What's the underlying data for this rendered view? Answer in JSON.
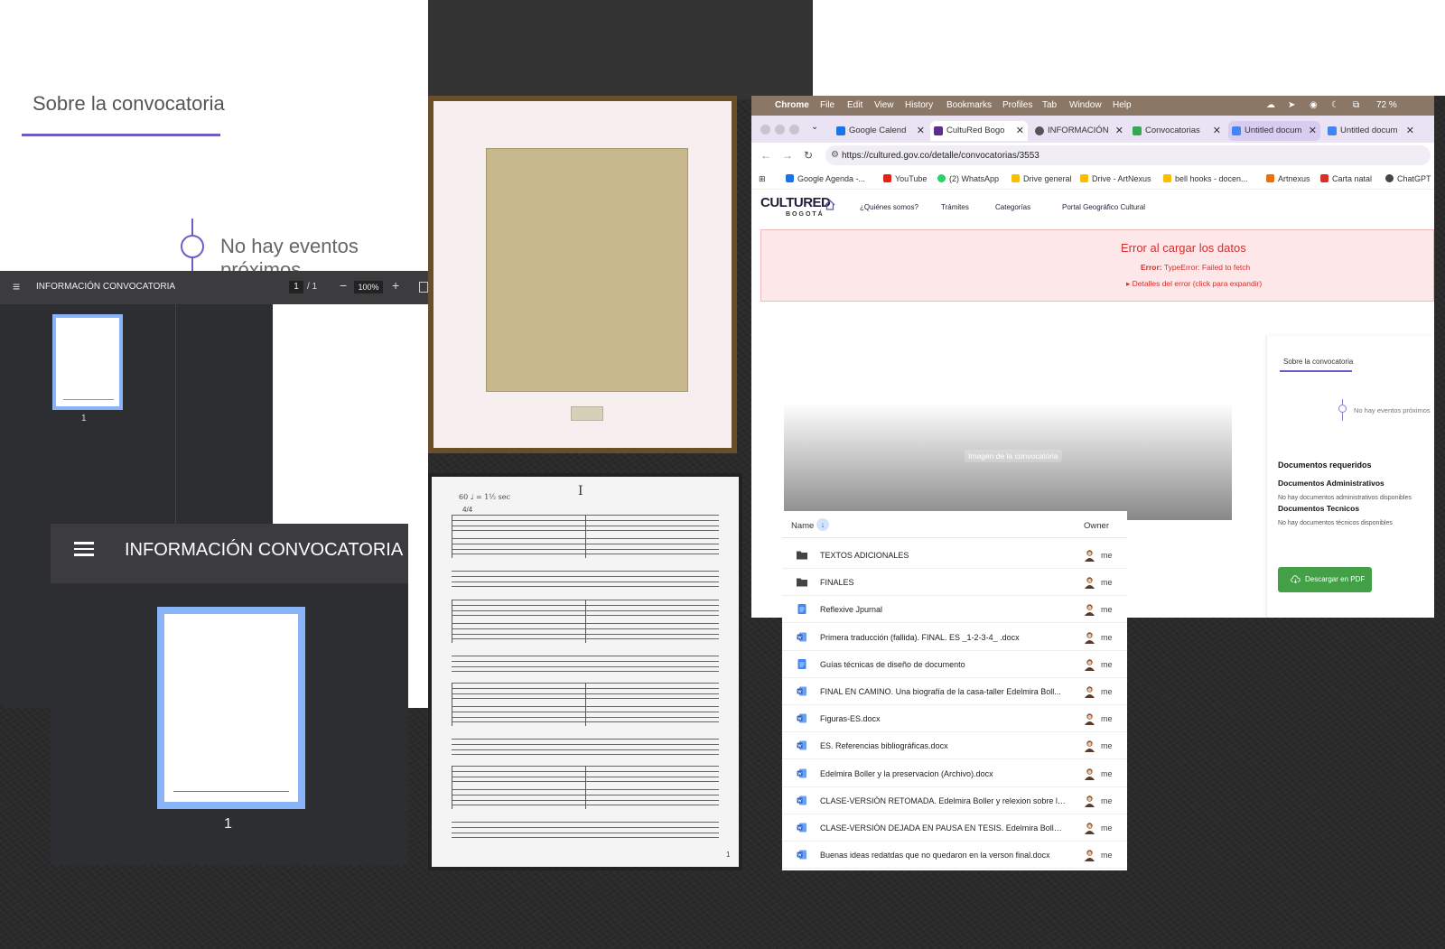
{
  "sobre_panel": {
    "title": "Sobre la convocatoria",
    "no_events": "No hay eventos próximos"
  },
  "pdf_viewer": {
    "title": "INFORMACIÓN CONVOCATORIA",
    "page_current": "1",
    "page_sep": "/ 1",
    "zoom": "100%",
    "thumb_number": "1"
  },
  "zoom_viewer": {
    "title": "INFORMACIÓN CONVOCATORIA",
    "thumb_number": "1"
  },
  "sheet_music": {
    "tempo": "60 ♩ = 1½ sec",
    "meter": "4/4",
    "roman": "I",
    "page_number": "1"
  },
  "mac_menubar": {
    "app": "Chrome",
    "items": [
      "File",
      "Edit",
      "View",
      "History",
      "Bookmarks",
      "Profiles",
      "Tab",
      "Window",
      "Help"
    ],
    "battery": "72 %"
  },
  "tabs": [
    {
      "label": "Google Calend",
      "fav_color": "#1a73e8"
    },
    {
      "label": "CultuRed Bogo",
      "fav_color": "#5b2d91"
    },
    {
      "label": "INFORMACIÓN",
      "fav_color": "#555555"
    },
    {
      "label": "Convocatorias",
      "fav_color": "#34a853"
    },
    {
      "label": "Untitled docum",
      "fav_color": "#4285f4"
    },
    {
      "label": "Untitled docum",
      "fav_color": "#4285f4"
    }
  ],
  "address": {
    "url": "https://cultured.gov.co/detalle/convocatorias/3553"
  },
  "bookmarks": [
    {
      "label": "Google Agenda -...",
      "color": "#1a73e8"
    },
    {
      "label": "YouTube",
      "color": "#e62117"
    },
    {
      "label": "(2) WhatsApp",
      "color": "#25d366"
    },
    {
      "label": "Drive general",
      "color": "#fbbc04"
    },
    {
      "label": "Drive - ArtNexus",
      "color": "#fbbc04"
    },
    {
      "label": "bell hooks - docen...",
      "color": "#fbbc04"
    },
    {
      "label": "Artnexus",
      "color": "#e8710a"
    },
    {
      "label": "Carta natal",
      "color": "#d93025"
    },
    {
      "label": "ChatGPT",
      "color": "#444444"
    }
  ],
  "site": {
    "logo": "CULTURED",
    "logo_sub": "BOGOTÁ",
    "nav": [
      "¿Quiénes somos?",
      "Trámites",
      "Categorías",
      "Portal Geográfico Cultural"
    ],
    "error_title": "Error al cargar los datos",
    "error_label": "Error:",
    "error_msg": "TypeError: Failed to fetch",
    "error_details": "▸ Detalles del error (click para expandir)",
    "image_alt": "Imagen de la convocatoria",
    "side_title": "Sobre la convocatoria",
    "side_no_events": "No hay eventos próximos",
    "docs_required": "Documentos requeridos",
    "docs_admin": "Documentos Administrativos",
    "docs_admin_none": "No hay documentos administrativos disponibles",
    "docs_tec": "Documentos Tecnicos",
    "docs_tec_none": "No hay documentos técnicos disponibles",
    "pdf_button": "Descargar en PDF",
    "accent_color": "#6b5fc7",
    "button_color": "#43a047"
  },
  "drive": {
    "col_name": "Name",
    "col_owner": "Owner",
    "rows": [
      {
        "name": "TEXTOS ADICIONALES",
        "type": "folder",
        "owner": "me"
      },
      {
        "name": "FINALES",
        "type": "folder",
        "owner": "me"
      },
      {
        "name": "Reflexive Jpurnal",
        "type": "gdoc",
        "owner": "me"
      },
      {
        "name": "Primera traducción (fallida). FINAL. ES _1-2-3-4_ .docx",
        "type": "word",
        "owner": "me"
      },
      {
        "name": "Guías técnicas de diseño de documento",
        "type": "gdoc",
        "owner": "me"
      },
      {
        "name": "FINAL EN CAMINO.  Una biografía de la casa-taller Edelmira Boll...",
        "type": "word",
        "owner": "me"
      },
      {
        "name": "Figuras-ES.docx",
        "type": "word",
        "owner": "me"
      },
      {
        "name": "ES. Referencias bibliográficas.docx",
        "type": "word",
        "owner": "me"
      },
      {
        "name": "Edelmira Boller y la preservacion (Archivo).docx",
        "type": "word",
        "owner": "me"
      },
      {
        "name": "CLASE-VERSIÓN RETOMADA. Edelmira Boller y relexion sobre la...",
        "type": "word",
        "owner": "me"
      },
      {
        "name": "CLASE-VERSIÓN DEJADA EN PAUSA EN TESIS. Edelmira Boller y...",
        "type": "word",
        "owner": "me"
      },
      {
        "name": "Buenas ideas redatdas que no quedaron en la verson final.docx",
        "type": "word",
        "owner": "me"
      }
    ]
  }
}
